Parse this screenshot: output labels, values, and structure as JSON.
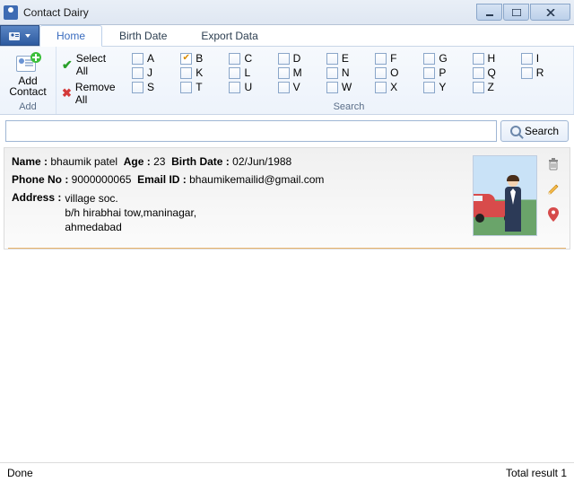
{
  "window": {
    "title": "Contact Dairy"
  },
  "tabs": {
    "home": "Home",
    "birth": "Birth Date",
    "export": "Export Data"
  },
  "ribbon": {
    "add_contact": "Add\nContact",
    "add_group": "Add",
    "select_all": "Select All",
    "remove_all": "Remove All",
    "search_group": "Search",
    "letters": [
      "A",
      "B",
      "C",
      "D",
      "E",
      "F",
      "G",
      "H",
      "I",
      "J",
      "K",
      "L",
      "M",
      "N",
      "O",
      "P",
      "Q",
      "R",
      "S",
      "T",
      "U",
      "V",
      "W",
      "X",
      "Y",
      "Z"
    ],
    "checked_letter": "B"
  },
  "search": {
    "placeholder": "",
    "button": "Search"
  },
  "result": {
    "name_label": "Name :",
    "name": "bhaumik patel",
    "age_label": "Age :",
    "age": "23",
    "birth_label": "Birth Date :",
    "birth": "02/Jun/1988",
    "phone_label": "Phone No :",
    "phone": "9000000065",
    "email_label": "Email ID :",
    "email": "bhaumikemailid@gmail.com",
    "address_label": "Address :",
    "address_lines": [
      "village soc.",
      "b/h hirabhai tow,maninagar,",
      "ahmedabad"
    ]
  },
  "status": {
    "left": "Done",
    "right": "Total result 1"
  }
}
